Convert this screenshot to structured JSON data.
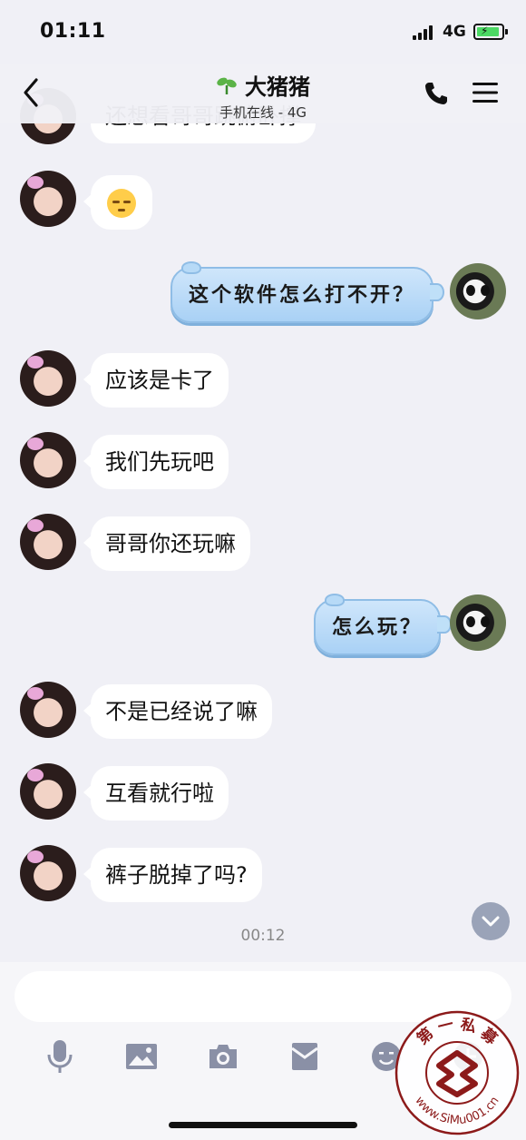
{
  "status_bar": {
    "time": "01:11",
    "network": "4G"
  },
  "header": {
    "title": "大猪猪",
    "subtitle": "手机在线 - 4G"
  },
  "messages": {
    "m0": "还想看哥哥跳俯卧撑",
    "m2": "这个软件怎么打不开？",
    "m3": "应该是卡了",
    "m4": "我们先玩吧",
    "m5": "哥哥你还玩嘛",
    "m6": "怎么玩？",
    "m7": "不是已经说了嘛",
    "m8": "互看就行啦",
    "m9": "裤子脱掉了吗?"
  },
  "timestamp": "00:12",
  "input": {
    "value": "",
    "placeholder": ""
  },
  "toolbar": {
    "icons": [
      "microphone-icon",
      "image-icon",
      "camera-icon",
      "red-envelope-icon",
      "emoji-icon",
      "plus-icon"
    ]
  },
  "watermark": {
    "top_text": "第 一 私 募",
    "bottom_text": "www.SiMu001.cn"
  },
  "colors": {
    "background": "#f0f0f6",
    "bubble_incoming": "#ffffff",
    "bubble_outgoing": "#a9d1f5",
    "battery": "#4cd964"
  }
}
